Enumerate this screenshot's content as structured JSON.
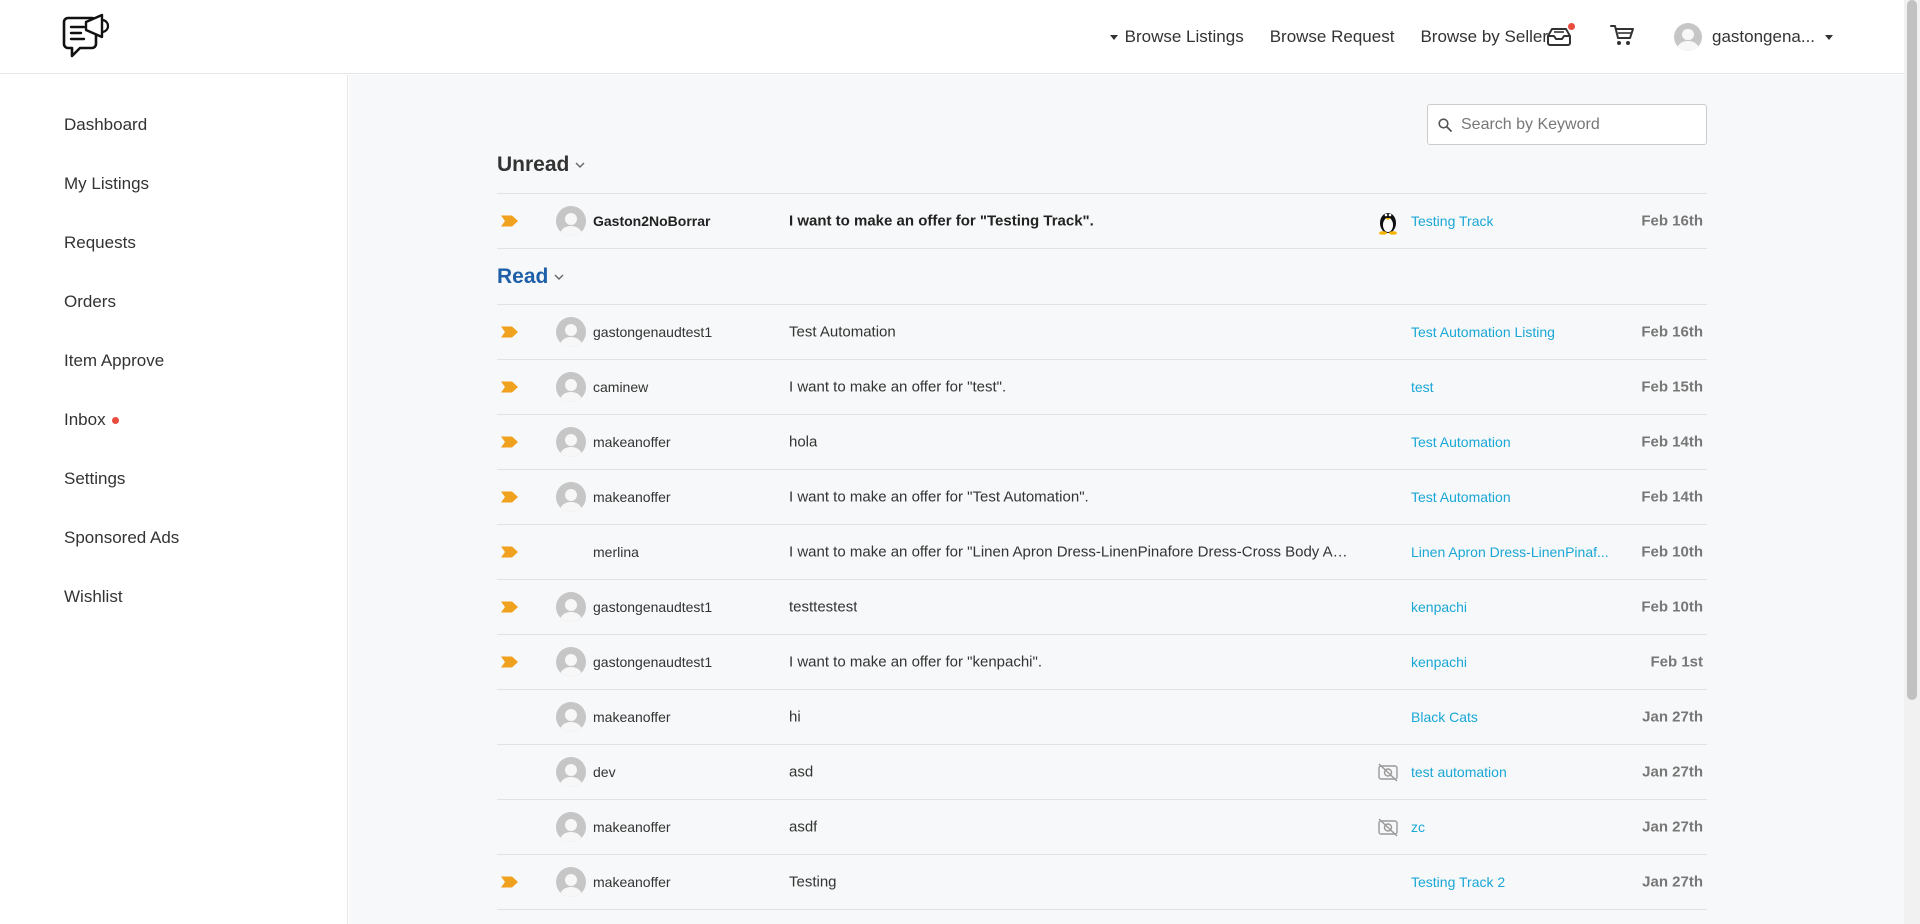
{
  "header": {
    "logo_icon": "megaphone-chat-logo-icon",
    "nav": {
      "browse_listings": "Browse Listings",
      "browse_request": "Browse Request",
      "browse_by_seller": "Browse by Seller"
    },
    "inbox_icon": "inbox-tray-icon",
    "cart_icon": "cart-icon",
    "user_name": "gastongena..."
  },
  "sidebar": {
    "items": [
      {
        "label": "Dashboard"
      },
      {
        "label": "My Listings"
      },
      {
        "label": "Requests"
      },
      {
        "label": "Orders"
      },
      {
        "label": "Item Approve"
      },
      {
        "label": "Inbox"
      },
      {
        "label": "Settings"
      },
      {
        "label": "Sponsored Ads"
      },
      {
        "label": "Wishlist"
      }
    ]
  },
  "search": {
    "placeholder": "Search by Keyword",
    "value": ""
  },
  "sections": {
    "unread_title": "Unread",
    "read_title": "Read"
  },
  "unread": [
    {
      "sender": "Gaston2NoBorrar",
      "subject": "I want to make an offer for \"Testing Track\".",
      "listing": "Testing Track",
      "date": "Feb 16th",
      "thumb": "penguin",
      "tag": true,
      "avatar": true
    }
  ],
  "read": [
    {
      "sender": "gastongenaudtest1",
      "subject": "Test Automation",
      "listing": "Test Automation Listing",
      "date": "Feb 16th",
      "thumb": "",
      "tag": true,
      "avatar": true
    },
    {
      "sender": "caminew",
      "subject": "I want to make an offer for \"test\".",
      "listing": "test",
      "date": "Feb 15th",
      "thumb": "",
      "tag": true,
      "avatar": true
    },
    {
      "sender": "makeanoffer",
      "subject": "hola",
      "listing": "Test Automation",
      "date": "Feb 14th",
      "thumb": "",
      "tag": true,
      "avatar": true
    },
    {
      "sender": "makeanoffer",
      "subject": "I want to make an offer for \"Test Automation\".",
      "listing": "Test Automation",
      "date": "Feb 14th",
      "thumb": "",
      "tag": true,
      "avatar": true
    },
    {
      "sender": "merlina",
      "subject": "I want to make an offer for \"Linen Apron Dress-LinenPinafore Dress-Cross Body Apr...",
      "listing": "Linen Apron Dress-LinenPinaf...",
      "date": "Feb 10th",
      "thumb": "",
      "tag": true,
      "avatar": false
    },
    {
      "sender": "gastongenaudtest1",
      "subject": "testtestest",
      "listing": "kenpachi",
      "date": "Feb 10th",
      "thumb": "",
      "tag": true,
      "avatar": true
    },
    {
      "sender": "gastongenaudtest1",
      "subject": "I want to make an offer for \"kenpachi\".",
      "listing": "kenpachi",
      "date": "Feb 1st",
      "thumb": "",
      "tag": true,
      "avatar": true
    },
    {
      "sender": "makeanoffer",
      "subject": "hi",
      "listing": "Black Cats",
      "date": "Jan 27th",
      "thumb": "",
      "tag": false,
      "avatar": true
    },
    {
      "sender": "dev",
      "subject": "asd",
      "listing": "test automation",
      "date": "Jan 27th",
      "thumb": "no-image",
      "tag": false,
      "avatar": true
    },
    {
      "sender": "makeanoffer",
      "subject": "asdf",
      "listing": "zc",
      "date": "Jan 27th",
      "thumb": "no-image",
      "tag": false,
      "avatar": true
    },
    {
      "sender": "makeanoffer",
      "subject": "Testing",
      "listing": "Testing Track 2",
      "date": "Jan 27th",
      "thumb": "",
      "tag": true,
      "avatar": true
    }
  ],
  "colors": {
    "accent_link": "#1aa7d6",
    "read_title": "#1f5fa8",
    "tag": "#f0a11d",
    "notification": "#e74c3c"
  }
}
